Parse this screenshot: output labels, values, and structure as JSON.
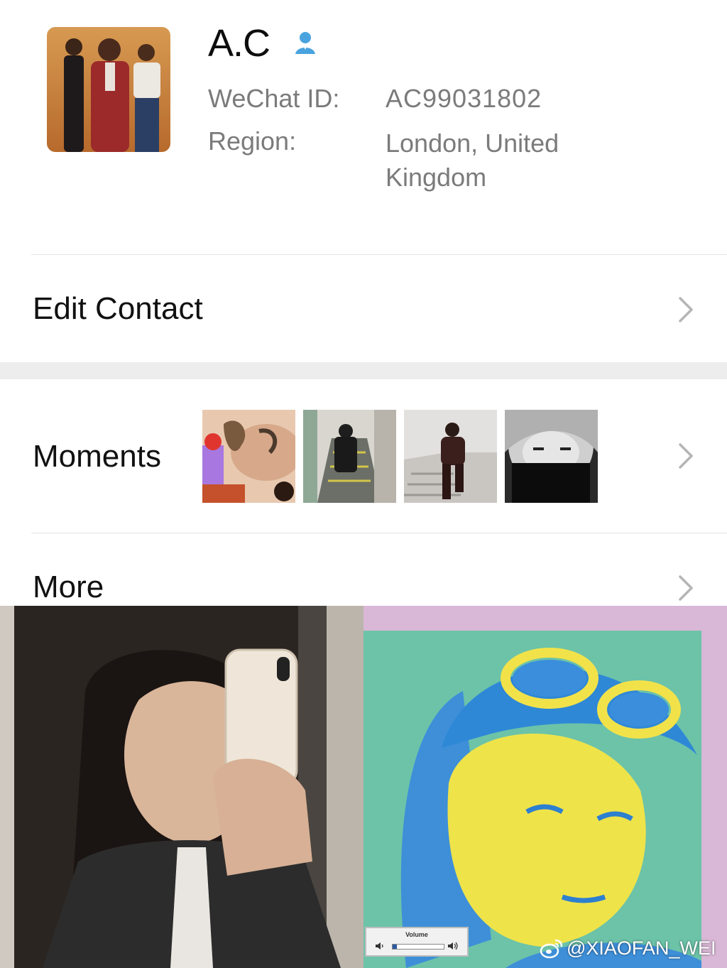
{
  "profile": {
    "name": "A.C",
    "wechat_id_label": "WeChat ID:",
    "wechat_id_value": "AC99031802",
    "region_label": "Region:",
    "region_value": "London, United Kingdom",
    "avatar_icon": "group-photo-avatar",
    "contact_icon": "person-icon"
  },
  "rows": {
    "edit_contact": "Edit Contact",
    "moments": "Moments",
    "more": "More"
  },
  "moments_thumbnails": [
    "thumbnail-1",
    "thumbnail-2",
    "thumbnail-3",
    "thumbnail-4"
  ],
  "volume": {
    "label": "Volume",
    "level": 0.08
  },
  "watermark": {
    "text": "@XIAOFAN_WEI",
    "icon": "weibo-icon"
  },
  "colors": {
    "accent_blue": "#4aa3df",
    "secondary_text": "#7b7b7b",
    "divider": "#e5e5e5",
    "group_gap": "#ededed"
  }
}
